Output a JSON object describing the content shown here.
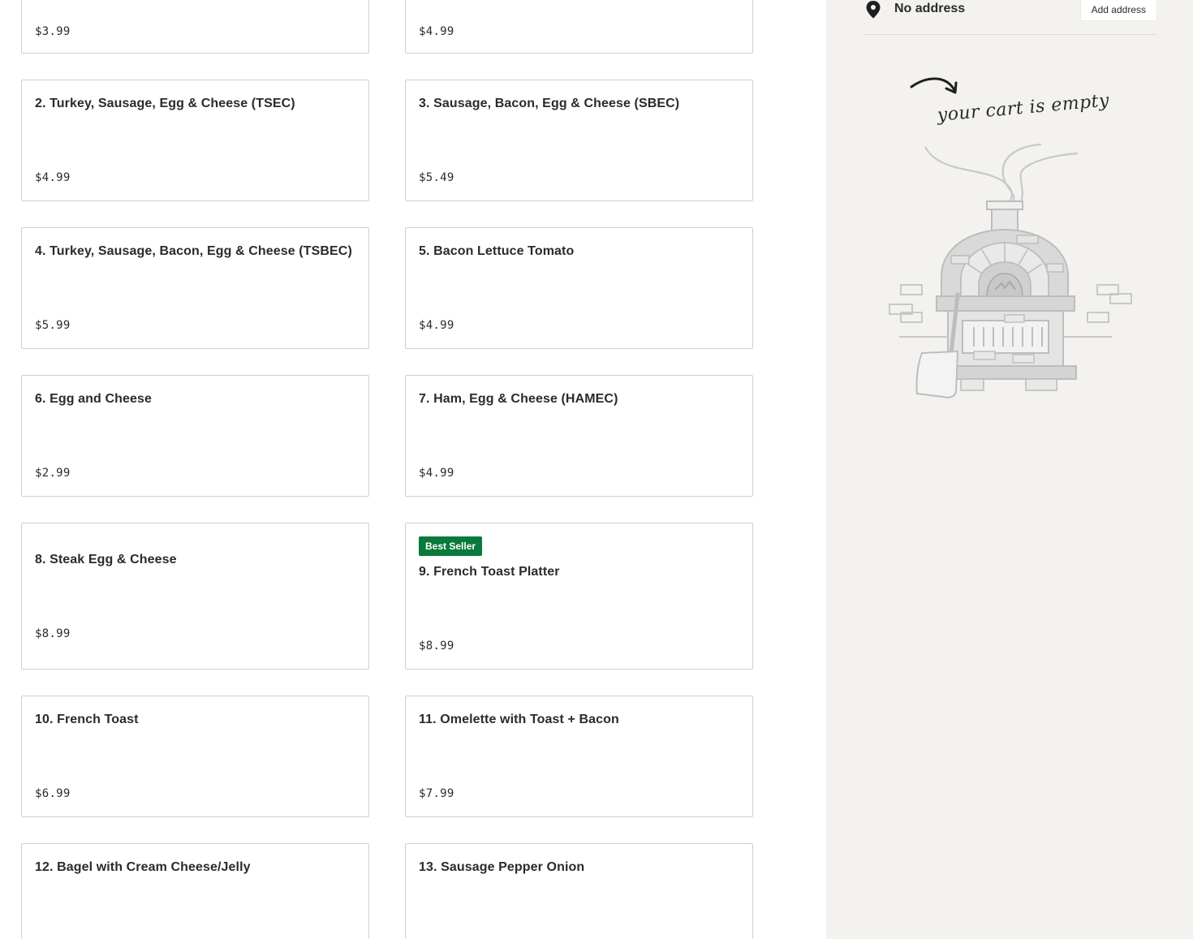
{
  "menu": {
    "items": [
      {
        "name": "",
        "price": "$3.99"
      },
      {
        "name": "",
        "price": "$4.99"
      },
      {
        "name": "2. Turkey, Sausage, Egg & Cheese (TSEC)",
        "price": "$4.99"
      },
      {
        "name": "3. Sausage, Bacon, Egg & Cheese (SBEC)",
        "price": "$5.49"
      },
      {
        "name": "4. Turkey, Sausage, Bacon, Egg & Cheese (TSBEC)",
        "price": "$5.99"
      },
      {
        "name": "5. Bacon Lettuce Tomato",
        "price": "$4.99"
      },
      {
        "name": "6. Egg and Cheese",
        "price": "$2.99"
      },
      {
        "name": "7. Ham, Egg & Cheese (HAMEC)",
        "price": "$4.99"
      },
      {
        "name": "8. Steak Egg & Cheese",
        "price": "$8.99"
      },
      {
        "name": "9. French Toast Platter",
        "price": "$8.99",
        "badge": "Best Seller"
      },
      {
        "name": "10. French Toast",
        "price": "$6.99"
      },
      {
        "name": "11. Omelette with Toast + Bacon",
        "price": "$7.99"
      },
      {
        "name": "12. Bagel with Cream Cheese/Jelly",
        "price": ""
      },
      {
        "name": "13. Sausage Pepper Onion",
        "price": ""
      }
    ]
  },
  "sidebar": {
    "address_text": "No address",
    "add_address_label": "Add address",
    "cart_empty_text": "your cart is empty"
  },
  "icons": {
    "address": "map-pin-icon",
    "cart_illustration": "pizza-oven-illustration"
  },
  "colors": {
    "badge_bg": "#0a7a3a",
    "sidebar_bg": "#f3f2ef",
    "card_border": "#cfcfcf"
  }
}
